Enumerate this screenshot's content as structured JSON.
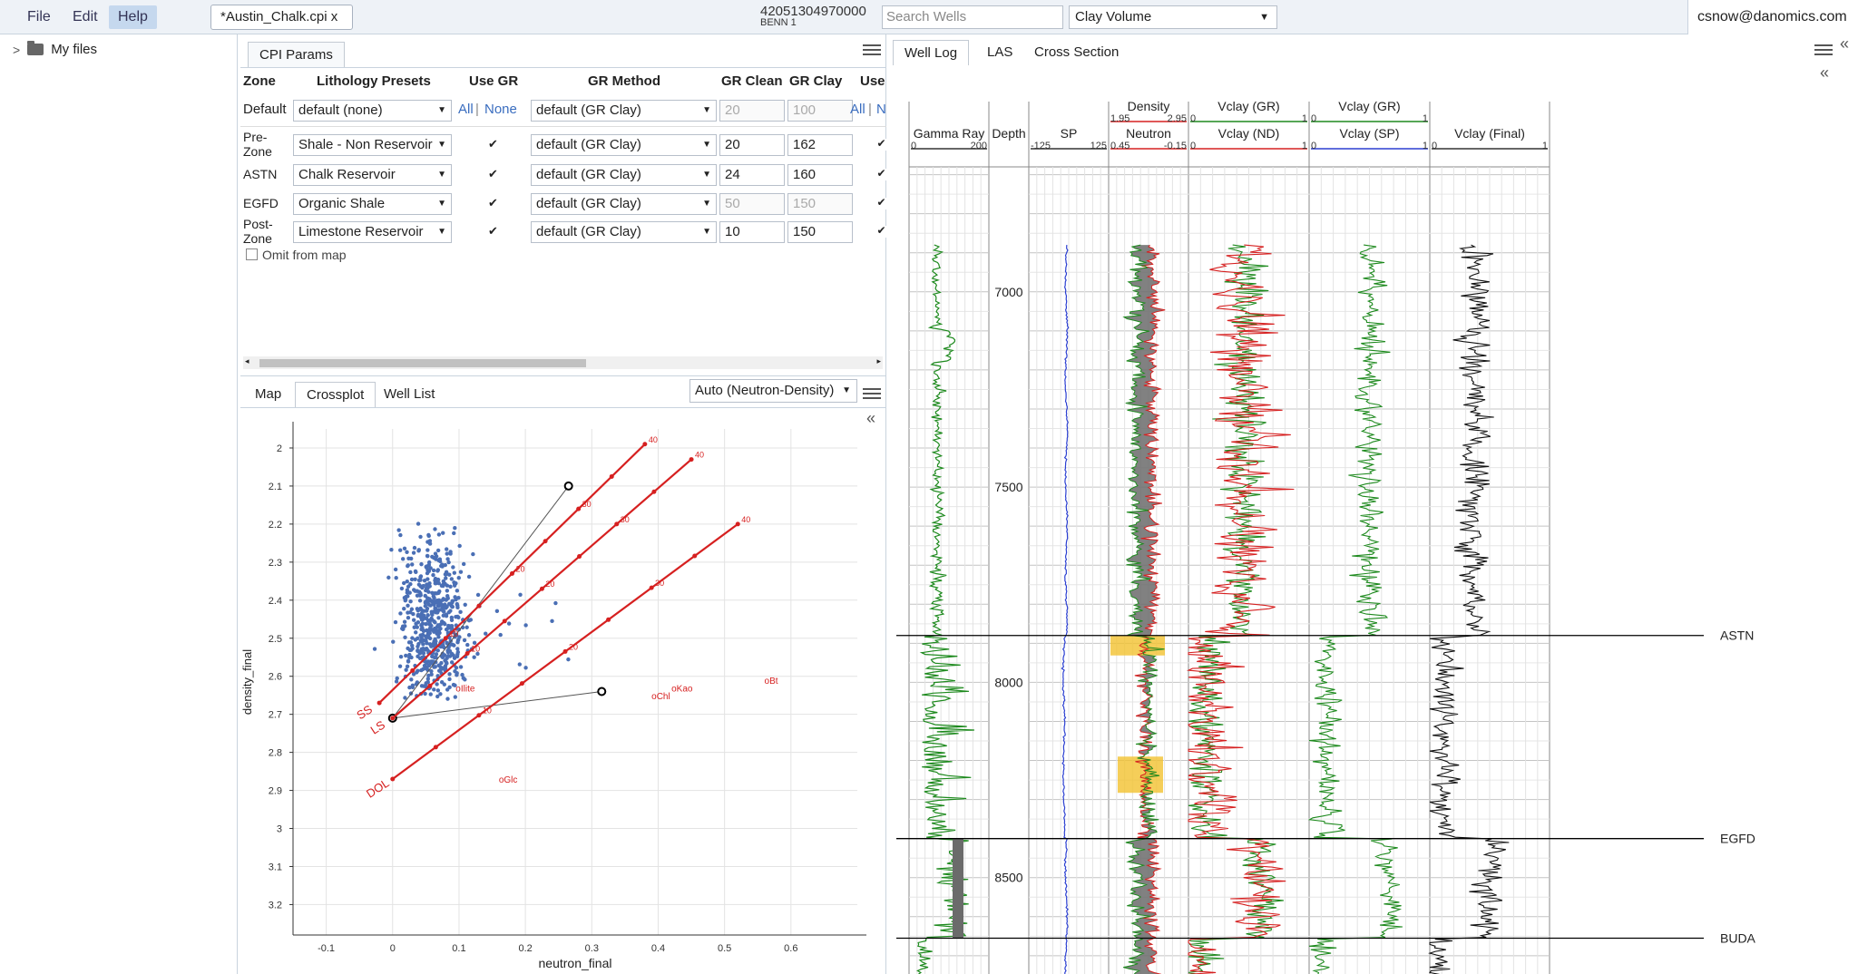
{
  "menu": {
    "file": "File",
    "edit": "Edit",
    "help": "Help"
  },
  "file_tab": "*Austin_Chalk.cpi x",
  "well": {
    "api": "42051304970000",
    "name": "BENN 1"
  },
  "search": {
    "placeholder": "Search Wells"
  },
  "view_select": "Clay Volume",
  "user": "csnow@danomics.com",
  "sidebar": {
    "my_files": "My files"
  },
  "cpi": {
    "tab": "CPI Params",
    "headers": {
      "zone": "Zone",
      "presets": "Lithology Presets",
      "use_gr": "Use GR",
      "gr_method": "GR Method",
      "gr_clean": "GR Clean",
      "gr_clay": "GR Clay",
      "use": "Use"
    },
    "default_row": {
      "zone": "Default",
      "preset": "default (none)",
      "all": "All",
      "none": "None",
      "method": "default (GR Clay)",
      "clean": "20",
      "clay": "100",
      "all2": "All",
      "none2": "N"
    },
    "rows": [
      {
        "zone1": "Pre-",
        "zone2": "Zone",
        "preset": "Shale - Non Reservoir",
        "method": "default (GR Clay)",
        "clean": "20",
        "clay": "162"
      },
      {
        "zone1": "ASTN",
        "zone2": "",
        "preset": "Chalk Reservoir",
        "method": "default (GR Clay)",
        "clean": "24",
        "clay": "160"
      },
      {
        "zone1": "EGFD",
        "zone2": "",
        "preset": "Organic Shale",
        "method": "default (GR Clay)",
        "clean": "50",
        "clay": "150"
      },
      {
        "zone1": "Post-",
        "zone2": "Zone",
        "preset": "Limestone Reservoir",
        "method": "default (GR Clay)",
        "clean": "10",
        "clay": "150"
      }
    ],
    "omit": "Omit from map"
  },
  "crossplot": {
    "tabs": {
      "map": "Map",
      "crossplot": "Crossplot",
      "well_list": "Well List"
    },
    "mode": "Auto (Neutron-Density)",
    "xlabel": "neutron_final",
    "ylabel": "density_final",
    "x_ticks": [
      "-0.1",
      "0",
      "0.1",
      "0.2",
      "0.3",
      "0.4",
      "0.5",
      "0.6"
    ],
    "y_ticks": [
      "2",
      "2.1",
      "2.2",
      "2.3",
      "2.4",
      "2.5",
      "2.6",
      "2.7",
      "2.8",
      "2.9",
      "3",
      "3.1",
      "3.2"
    ],
    "xlim": [
      -0.15,
      0.7
    ],
    "ylim": [
      1.95,
      3.28
    ],
    "lines": [
      {
        "label": "SS",
        "x0": -0.02,
        "y0": 2.67,
        "x1": 0.38,
        "y1": 1.99
      },
      {
        "label": "LS",
        "x0": 0.0,
        "y0": 2.71,
        "x1": 0.45,
        "y1": 2.03
      },
      {
        "label": "DOL",
        "x0": 0.0,
        "y0": 2.87,
        "x1": 0.52,
        "y1": 2.2
      }
    ],
    "minerals": [
      {
        "label": "Kao",
        "x": 0.42,
        "y": 2.64
      },
      {
        "label": "Chl",
        "x": 0.39,
        "y": 2.66
      },
      {
        "label": "Bt",
        "x": 0.56,
        "y": 2.62
      },
      {
        "label": "Glc",
        "x": 0.16,
        "y": 2.88
      },
      {
        "label": "Ilite",
        "x": 0.095,
        "y": 2.64
      }
    ]
  },
  "welllog": {
    "tabs": {
      "well_log": "Well Log",
      "las": "LAS",
      "cross_section": "Cross Section"
    },
    "tracks": {
      "gamma": {
        "label": "Gamma Ray",
        "min": "0",
        "max": "200"
      },
      "depth": {
        "label": "Depth"
      },
      "sp": {
        "label": "SP",
        "min": "-125",
        "max": "125"
      },
      "density": {
        "label": "Density",
        "min": "1.95",
        "max": "2.95"
      },
      "neutron": {
        "label": "Neutron",
        "min": "0.45",
        "max": "-0.15"
      },
      "vclay_gr": {
        "label": "Vclay (GR)",
        "min": "0",
        "max": "1"
      },
      "vclay_nd": {
        "label": "Vclay (ND)",
        "min": "0",
        "max": "1"
      },
      "vclay_gr2": {
        "label": "Vclay (GR)",
        "min": "0",
        "max": "1"
      },
      "vclay_sp": {
        "label": "Vclay (SP)",
        "min": "0",
        "max": "1"
      },
      "vclay_final": {
        "label": "Vclay (Final)",
        "min": "0",
        "max": "1"
      }
    },
    "depth_ticks": [
      "7000",
      "7500",
      "8000",
      "8500"
    ],
    "tops": [
      "ASTN",
      "EGFD",
      "BUDA"
    ]
  },
  "colors": {
    "accent": "#3a6dbf",
    "overlay_red": "#d62020",
    "gr_green": "#1e8a1e",
    "sp_blue": "#2b3fd1",
    "fill_gray": "#6b6b6b",
    "fill_yellow": "#f2c230"
  }
}
